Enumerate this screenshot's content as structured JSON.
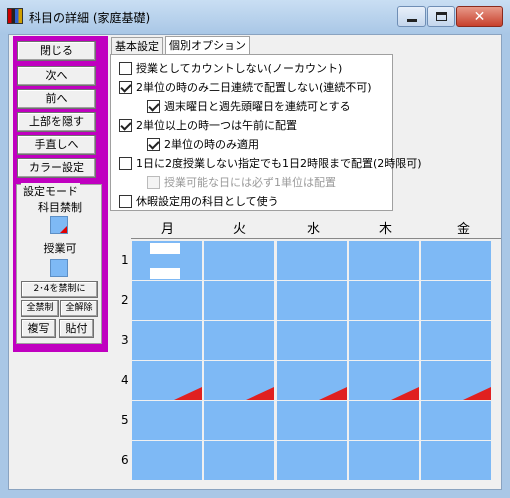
{
  "window": {
    "title": "科目の詳細 (家庭基礎)",
    "icons": {
      "app": "app-grid-icon",
      "minimize": "minimize-icon",
      "maximize": "maximize-icon",
      "close": "close-icon"
    },
    "close_glyph": "✕"
  },
  "left_panel": {
    "buttons": [
      "閉じる",
      "次へ",
      "前へ",
      "上部を隠す",
      "手直しへ",
      "カラー設定"
    ],
    "mode": {
      "title": "設定モード",
      "forbidden_label": "科目禁制",
      "allowed_label": "授業可",
      "small_buttons": {
        "set_24": "2･4を禁制に",
        "forbid_all": "全禁制",
        "release_all": "全解除",
        "copy": "複写",
        "paste": "貼付"
      }
    }
  },
  "tabs": [
    {
      "label": "基本設定",
      "active": false
    },
    {
      "label": "個別オプション",
      "active": true
    }
  ],
  "options": [
    {
      "label": "授業としてカウントしない(ノーカウント)",
      "checked": false,
      "disabled": false
    },
    {
      "label": "2単位の時のみ二日連続で配置しない(連続不可)",
      "checked": true,
      "disabled": false
    },
    {
      "label": "週末曜日と週先頭曜日を連続可とする",
      "checked": true,
      "disabled": false
    },
    {
      "label": "2単位以上の時一つは午前に配置",
      "checked": true,
      "disabled": false
    },
    {
      "label": "2単位の時のみ適用",
      "checked": true,
      "disabled": false
    },
    {
      "label": "1日に2度授業しない指定でも1日2時限まで配置(2時限可)",
      "checked": false,
      "disabled": false
    },
    {
      "label": "授業可能な日には必ず1単位は配置",
      "checked": false,
      "disabled": true
    },
    {
      "label": "休暇設定用の科目として使う",
      "checked": false,
      "disabled": false
    }
  ],
  "grid": {
    "days": [
      "月",
      "火",
      "水",
      "木",
      "金"
    ],
    "periods": [
      "1",
      "2",
      "3",
      "4",
      "5",
      "6"
    ],
    "colors": {
      "allowed": "#7eb9f5",
      "forbidden_marker": "#e02020"
    },
    "forbidden_period": "4"
  }
}
